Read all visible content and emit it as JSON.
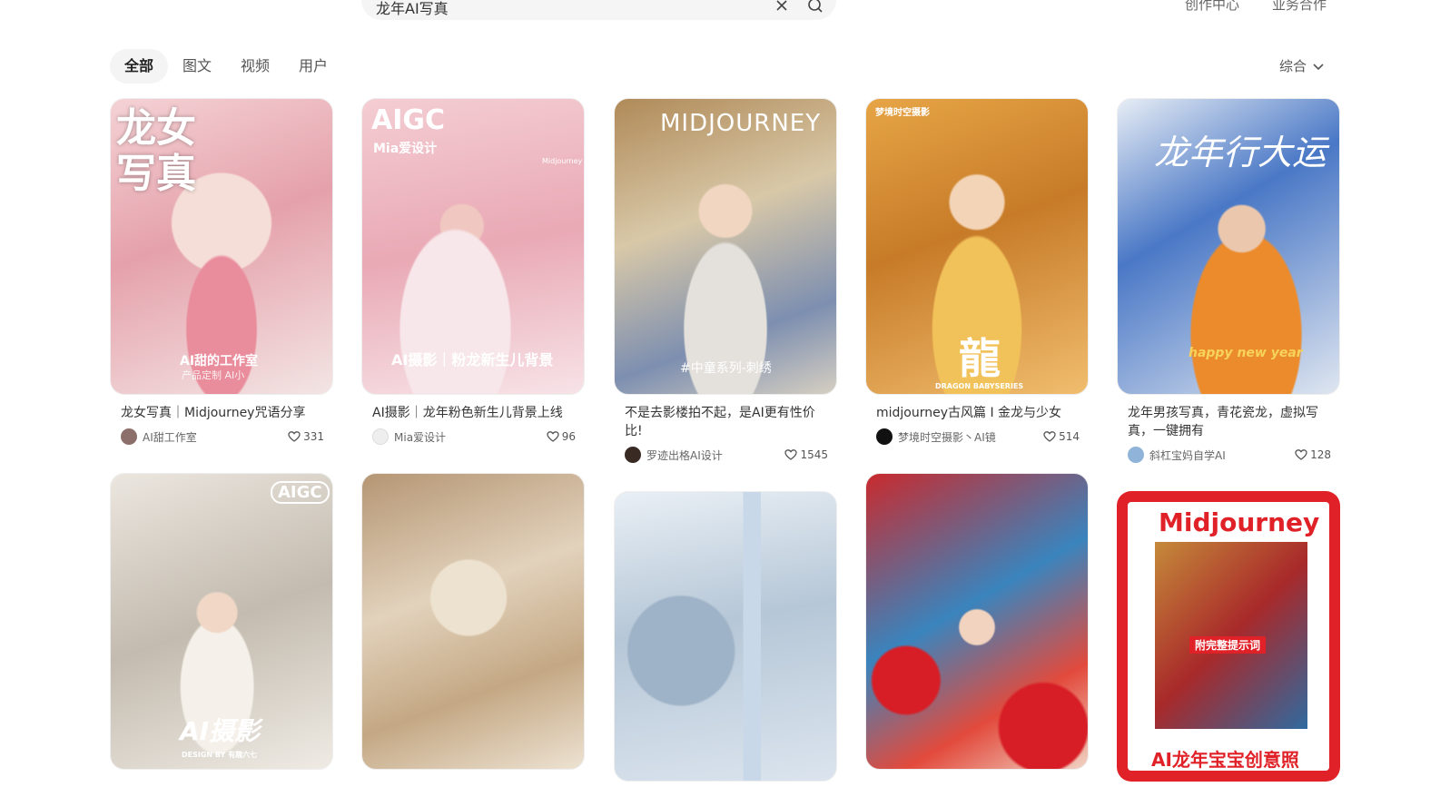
{
  "search": {
    "query": "龙年AI写真"
  },
  "top_links": [
    "创作中心",
    "业务合作"
  ],
  "tabs": [
    "全部",
    "图文",
    "视频",
    "用户"
  ],
  "active_tab": "全部",
  "sort_label": "综合",
  "cards": [
    {
      "title": "龙女写真｜Midjourney咒语分享",
      "author": "AI甜工作室",
      "likes": "331",
      "cover_text": [
        "龙女",
        "写真",
        "AI甜的工作室",
        "产品定制 AI小"
      ],
      "colors": [
        "#f0c8cc",
        "#e7a3ac",
        "#f6e3e1"
      ]
    },
    {
      "title": "AI摄影｜龙年粉色新生儿背景上线",
      "author": "Mia爱设计",
      "likes": "96",
      "cover_text": [
        "AIGC",
        "Mia爱设计",
        "AI摄影｜粉龙新生儿背景",
        "Midjourney"
      ],
      "colors": [
        "#f2c6cd",
        "#e8a5b1",
        "#f7e2e6"
      ]
    },
    {
      "title": "不是去影楼拍不起，是AI更有性价比!",
      "author": "罗迹出格AI设计",
      "likes": "1545",
      "cover_text": [
        "MIDJOURNEY",
        "#中童系列-刺绣"
      ],
      "colors": [
        "#c9a878",
        "#a08860",
        "#d4cbbd"
      ]
    },
    {
      "title": "midjourney古风篇 I 金龙与少女",
      "author": "梦境时空摄影丶AI镜",
      "likes": "514",
      "cover_text": [
        "龍",
        "DRAGON BABYSERIES",
        "梦境时空摄影"
      ],
      "colors": [
        "#e2a04a",
        "#c47a2a",
        "#f0c27a"
      ]
    },
    {
      "title": "龙年男孩写真，青花瓷龙，虚拟写真，一键拥有",
      "author": "斜杠宝妈自学AI",
      "likes": "128",
      "cover_text": [
        "龙年行大运",
        "happy new year"
      ],
      "colors": [
        "#3c6cc0",
        "#e88a2a",
        "#dfe6f0"
      ]
    },
    {
      "title": "",
      "author": "",
      "likes": "",
      "cover_text": [
        "AIGC",
        "AI摄影",
        "DESIGN BY 有趣六七"
      ],
      "colors": [
        "#d9d3ca",
        "#bdb5a9",
        "#efebe4"
      ]
    },
    {
      "title": "",
      "author": "",
      "likes": "",
      "cover_text": [],
      "colors": [
        "#d6c2a7",
        "#b89e7e",
        "#ece0ce"
      ]
    },
    {
      "title": "",
      "author": "",
      "likes": "",
      "cover_text": [],
      "colors": [
        "#cfdbe6",
        "#a9bccd",
        "#e9eff5"
      ]
    },
    {
      "title": "",
      "author": "",
      "likes": "",
      "cover_text": [],
      "colors": [
        "#d7383a",
        "#3a7fb8",
        "#f2d0c0"
      ]
    },
    {
      "title": "",
      "author": "",
      "likes": "",
      "cover_text": [
        "Midjourney",
        "附完整提示词",
        "AI龙年宝宝创意照"
      ],
      "colors": [
        "#e02228",
        "#ffffff",
        "#c8882f"
      ]
    }
  ]
}
